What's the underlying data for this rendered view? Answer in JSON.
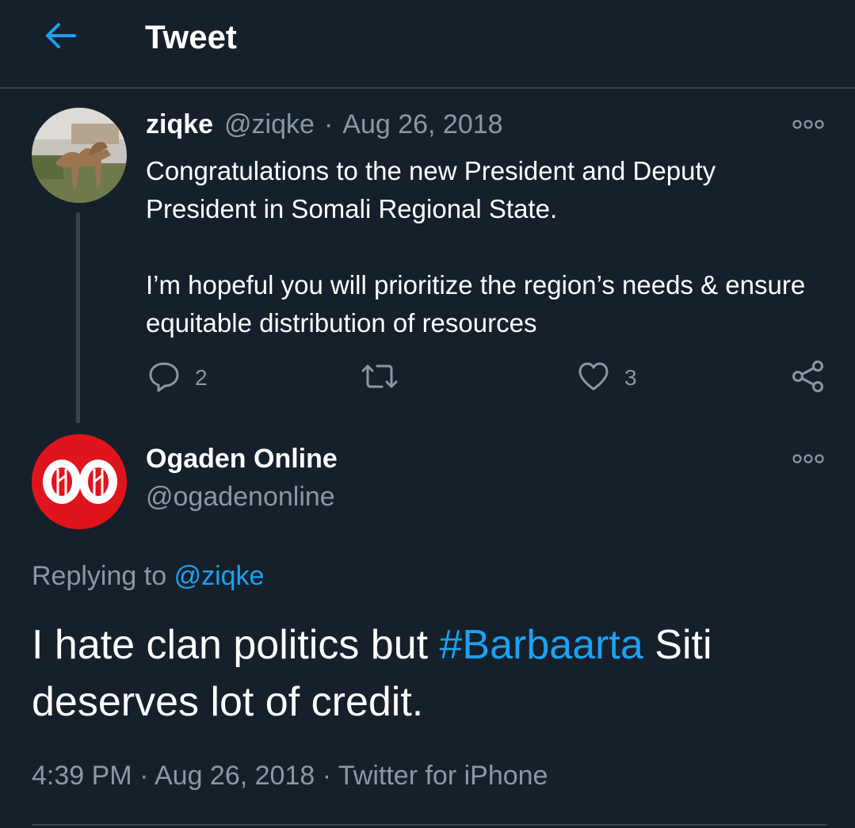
{
  "header": {
    "title": "Tweet",
    "back_icon": "arrow-left-icon"
  },
  "parent_tweet": {
    "display_name": "ziqke",
    "handle": "@ziqke",
    "separator": "·",
    "date": "Aug 26, 2018",
    "text_paragraph_1": "Congratulations to the new President and Deputy President in Somali Regional State.",
    "text_paragraph_2": "I’m hopeful you will prioritize the region’s needs & ensure equitable distribution of resources",
    "reply_count": "2",
    "retweet_count": "",
    "like_count": "3",
    "more_icon": "more-horizontal-icon"
  },
  "main_tweet": {
    "display_name": "Ogaden Online",
    "handle": "@ogadenonline",
    "replying_prefix": "Replying to",
    "replying_to": "@ziqke",
    "text_before": "I hate clan politics but ",
    "hashtag": "#Barbaarta",
    "text_after": " Siti deserves lot of credit.",
    "time": "4:39 PM",
    "separator": "·",
    "date": "Aug 26, 2018",
    "source": "Twitter for iPhone",
    "more_icon": "more-horizontal-icon"
  },
  "colors": {
    "background": "#15202b",
    "accent": "#1da1f2",
    "secondary_text": "#8899a6",
    "divider": "#38444d",
    "logo_red": "#e0141c"
  }
}
